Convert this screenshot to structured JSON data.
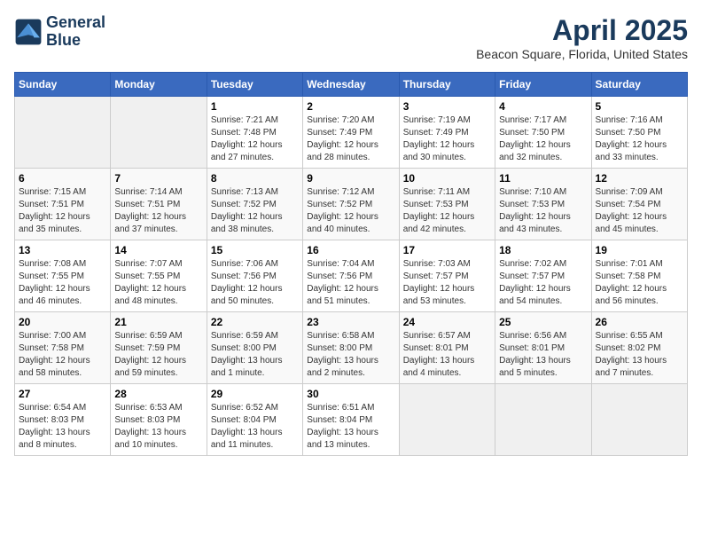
{
  "header": {
    "logo_line1": "General",
    "logo_line2": "Blue",
    "title": "April 2025",
    "subtitle": "Beacon Square, Florida, United States"
  },
  "days_of_week": [
    "Sunday",
    "Monday",
    "Tuesday",
    "Wednesday",
    "Thursday",
    "Friday",
    "Saturday"
  ],
  "weeks": [
    [
      {
        "num": "",
        "empty": true
      },
      {
        "num": "",
        "empty": true
      },
      {
        "num": "1",
        "sunrise": "7:21 AM",
        "sunset": "7:48 PM",
        "daylight": "12 hours and 27 minutes."
      },
      {
        "num": "2",
        "sunrise": "7:20 AM",
        "sunset": "7:49 PM",
        "daylight": "12 hours and 28 minutes."
      },
      {
        "num": "3",
        "sunrise": "7:19 AM",
        "sunset": "7:49 PM",
        "daylight": "12 hours and 30 minutes."
      },
      {
        "num": "4",
        "sunrise": "7:17 AM",
        "sunset": "7:50 PM",
        "daylight": "12 hours and 32 minutes."
      },
      {
        "num": "5",
        "sunrise": "7:16 AM",
        "sunset": "7:50 PM",
        "daylight": "12 hours and 33 minutes."
      }
    ],
    [
      {
        "num": "6",
        "sunrise": "7:15 AM",
        "sunset": "7:51 PM",
        "daylight": "12 hours and 35 minutes."
      },
      {
        "num": "7",
        "sunrise": "7:14 AM",
        "sunset": "7:51 PM",
        "daylight": "12 hours and 37 minutes."
      },
      {
        "num": "8",
        "sunrise": "7:13 AM",
        "sunset": "7:52 PM",
        "daylight": "12 hours and 38 minutes."
      },
      {
        "num": "9",
        "sunrise": "7:12 AM",
        "sunset": "7:52 PM",
        "daylight": "12 hours and 40 minutes."
      },
      {
        "num": "10",
        "sunrise": "7:11 AM",
        "sunset": "7:53 PM",
        "daylight": "12 hours and 42 minutes."
      },
      {
        "num": "11",
        "sunrise": "7:10 AM",
        "sunset": "7:53 PM",
        "daylight": "12 hours and 43 minutes."
      },
      {
        "num": "12",
        "sunrise": "7:09 AM",
        "sunset": "7:54 PM",
        "daylight": "12 hours and 45 minutes."
      }
    ],
    [
      {
        "num": "13",
        "sunrise": "7:08 AM",
        "sunset": "7:55 PM",
        "daylight": "12 hours and 46 minutes."
      },
      {
        "num": "14",
        "sunrise": "7:07 AM",
        "sunset": "7:55 PM",
        "daylight": "12 hours and 48 minutes."
      },
      {
        "num": "15",
        "sunrise": "7:06 AM",
        "sunset": "7:56 PM",
        "daylight": "12 hours and 50 minutes."
      },
      {
        "num": "16",
        "sunrise": "7:04 AM",
        "sunset": "7:56 PM",
        "daylight": "12 hours and 51 minutes."
      },
      {
        "num": "17",
        "sunrise": "7:03 AM",
        "sunset": "7:57 PM",
        "daylight": "12 hours and 53 minutes."
      },
      {
        "num": "18",
        "sunrise": "7:02 AM",
        "sunset": "7:57 PM",
        "daylight": "12 hours and 54 minutes."
      },
      {
        "num": "19",
        "sunrise": "7:01 AM",
        "sunset": "7:58 PM",
        "daylight": "12 hours and 56 minutes."
      }
    ],
    [
      {
        "num": "20",
        "sunrise": "7:00 AM",
        "sunset": "7:58 PM",
        "daylight": "12 hours and 58 minutes."
      },
      {
        "num": "21",
        "sunrise": "6:59 AM",
        "sunset": "7:59 PM",
        "daylight": "12 hours and 59 minutes."
      },
      {
        "num": "22",
        "sunrise": "6:59 AM",
        "sunset": "8:00 PM",
        "daylight": "13 hours and 1 minute."
      },
      {
        "num": "23",
        "sunrise": "6:58 AM",
        "sunset": "8:00 PM",
        "daylight": "13 hours and 2 minutes."
      },
      {
        "num": "24",
        "sunrise": "6:57 AM",
        "sunset": "8:01 PM",
        "daylight": "13 hours and 4 minutes."
      },
      {
        "num": "25",
        "sunrise": "6:56 AM",
        "sunset": "8:01 PM",
        "daylight": "13 hours and 5 minutes."
      },
      {
        "num": "26",
        "sunrise": "6:55 AM",
        "sunset": "8:02 PM",
        "daylight": "13 hours and 7 minutes."
      }
    ],
    [
      {
        "num": "27",
        "sunrise": "6:54 AM",
        "sunset": "8:03 PM",
        "daylight": "13 hours and 8 minutes."
      },
      {
        "num": "28",
        "sunrise": "6:53 AM",
        "sunset": "8:03 PM",
        "daylight": "13 hours and 10 minutes."
      },
      {
        "num": "29",
        "sunrise": "6:52 AM",
        "sunset": "8:04 PM",
        "daylight": "13 hours and 11 minutes."
      },
      {
        "num": "30",
        "sunrise": "6:51 AM",
        "sunset": "8:04 PM",
        "daylight": "13 hours and 13 minutes."
      },
      {
        "num": "",
        "empty": true
      },
      {
        "num": "",
        "empty": true
      },
      {
        "num": "",
        "empty": true
      }
    ]
  ],
  "labels": {
    "sunrise": "Sunrise:",
    "sunset": "Sunset:",
    "daylight": "Daylight:"
  }
}
